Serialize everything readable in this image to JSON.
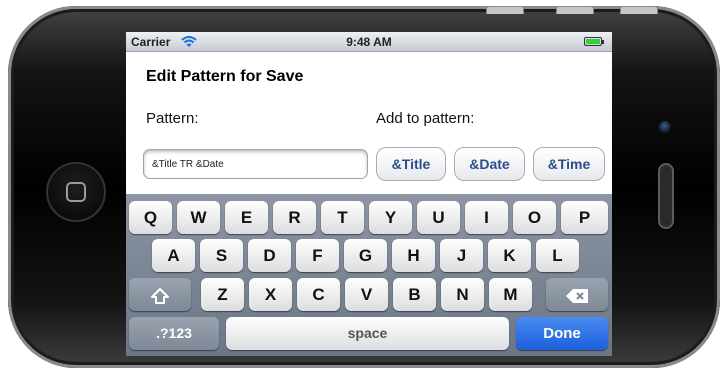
{
  "status_bar": {
    "carrier": "Carrier",
    "time": "9:48 AM"
  },
  "screen": {
    "title": "Edit Pattern for Save",
    "pattern_label": "Pattern:",
    "add_label": "Add to pattern:",
    "pattern_value": "&Title TR &Date",
    "tokens": [
      "&Title",
      "&Date",
      "&Time"
    ]
  },
  "keyboard": {
    "row1": [
      "Q",
      "W",
      "E",
      "R",
      "T",
      "Y",
      "U",
      "I",
      "O",
      "P"
    ],
    "row2": [
      "A",
      "S",
      "D",
      "F",
      "G",
      "H",
      "J",
      "K",
      "L"
    ],
    "row3": [
      "Z",
      "X",
      "C",
      "V",
      "B",
      "N",
      "M"
    ],
    "numbers_key": ".?123",
    "space_key": "space",
    "done_key": "Done",
    "shift_icon": "shift-icon",
    "backspace_icon": "backspace-icon"
  }
}
